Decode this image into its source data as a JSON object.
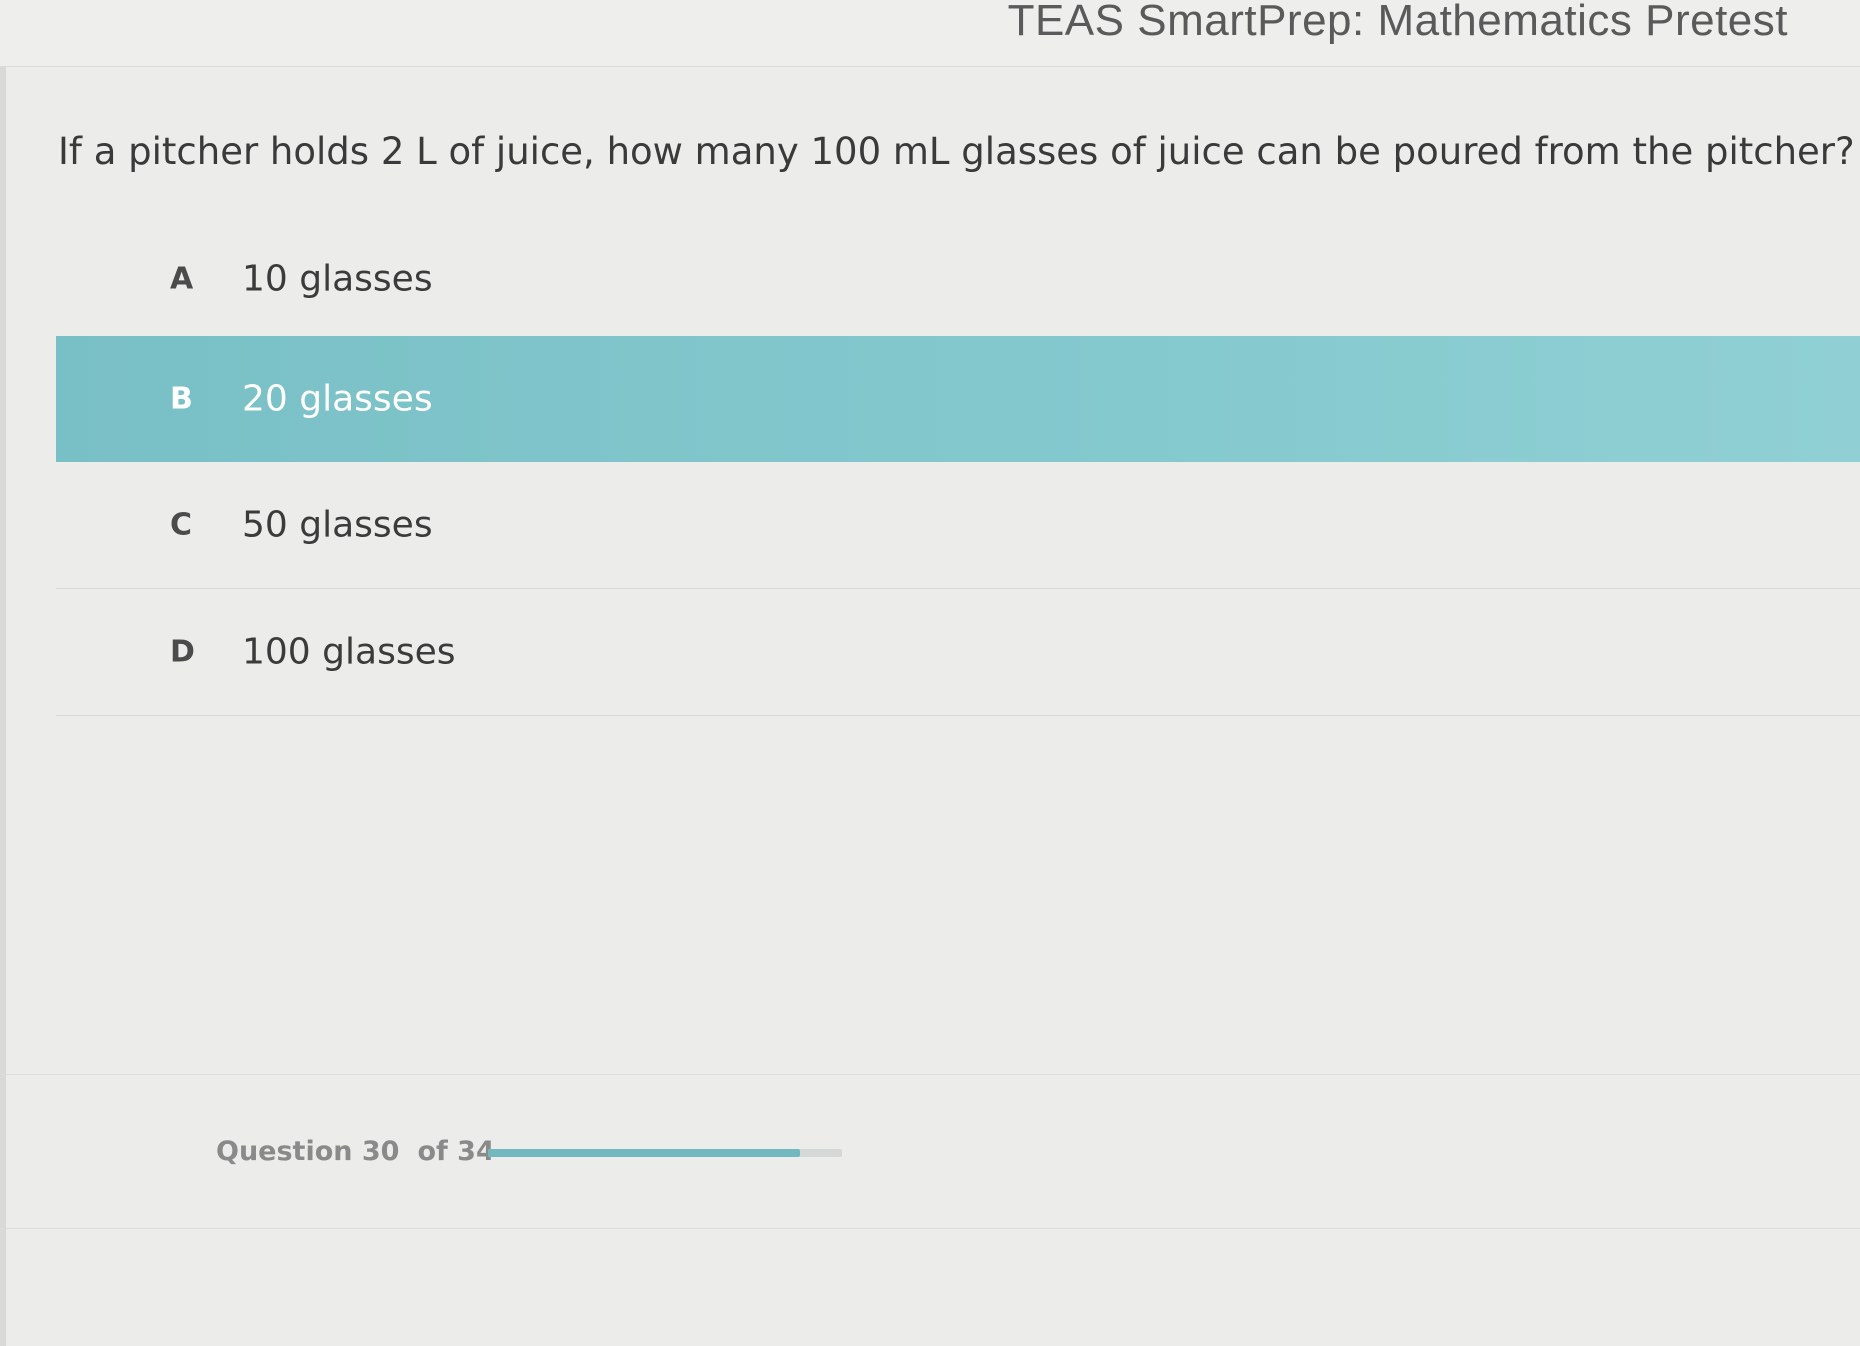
{
  "header": {
    "title": "TEAS SmartPrep: Mathematics Pretest"
  },
  "question": {
    "text": "If a pitcher holds 2 L of juice, how many 100 mL glasses of juice can be poured from the pitcher?"
  },
  "options": [
    {
      "letter": "A",
      "text": "10 glasses",
      "selected": false
    },
    {
      "letter": "B",
      "text": "20 glasses",
      "selected": true
    },
    {
      "letter": "C",
      "text": "50 glasses",
      "selected": false
    },
    {
      "letter": "D",
      "text": "100 glasses",
      "selected": false
    }
  ],
  "progress": {
    "question_label": "Question 30",
    "of_label": "of 34",
    "current": 30,
    "total": 34,
    "fill_fraction": 0.88
  },
  "colors": {
    "selected_bg": "#84c9ce",
    "progress_fill": "#74b8bf",
    "progress_track": "#d6d8d8"
  }
}
